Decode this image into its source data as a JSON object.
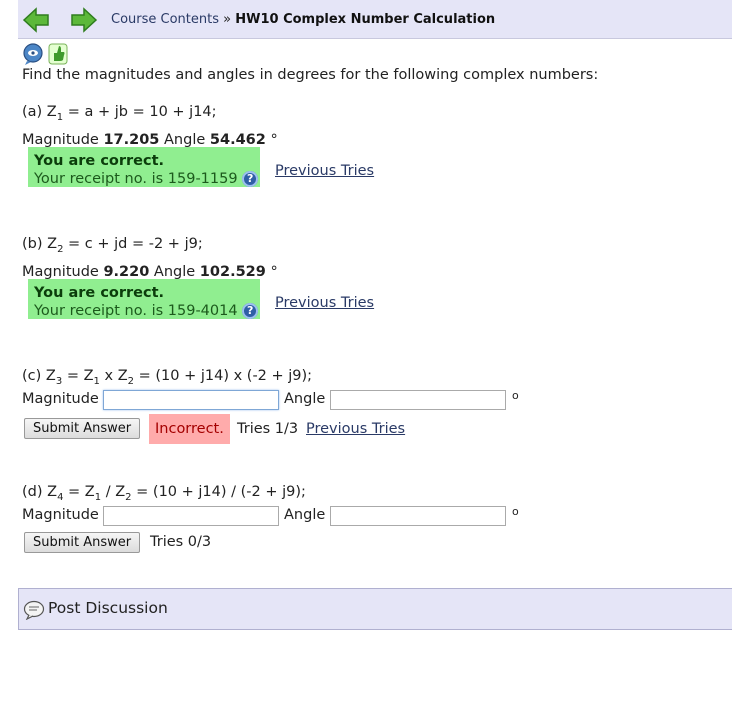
{
  "nav": {
    "back_icon": "back-arrow-icon",
    "forward_icon": "forward-arrow-icon",
    "breadcrumb_link": "Course Contents",
    "separator": "»",
    "current": "HW10 Complex Number Calculation"
  },
  "tools": {
    "icons": [
      "feedback-icon",
      "evaluate-icon"
    ]
  },
  "intro": "Find the magnitudes and angles in degrees for the following complex numbers:",
  "parts": {
    "a": {
      "label_pre": "(a) Z",
      "sub": "1",
      "label_post": " = a + jb = 10 + j14;",
      "mag_label": "Magnitude",
      "mag_value": "17.205",
      "angle_label": "Angle",
      "angle_value": "54.462",
      "deg": "°",
      "correct_title": "You are correct.",
      "receipt": "Your receipt no. is 159-1159",
      "previous": "Previous Tries"
    },
    "b": {
      "label_pre": "(b) Z",
      "sub": "2",
      "label_post": " = c + jd = -2 + j9;",
      "mag_label": "Magnitude",
      "mag_value": "9.220",
      "angle_label": "Angle",
      "angle_value": "102.529",
      "deg": "°",
      "correct_title": "You are correct.",
      "receipt": "Your receipt no. is 159-4014",
      "previous": "Previous Tries"
    },
    "c": {
      "label_pre": "(c) Z",
      "sub": "3",
      "mid1": " = Z",
      "sub1": "1",
      "mid2": " x Z",
      "sub2": "2",
      "label_post": " = (10 + j14) x (-2 + j9);",
      "mag_label": "Magnitude",
      "mag_value": "",
      "angle_label": "Angle",
      "angle_value": "",
      "deg": "o",
      "submit": "Submit Answer",
      "status": "Incorrect.",
      "tries": "Tries 1/3",
      "previous": "Previous Tries"
    },
    "d": {
      "label_pre": "(d) Z",
      "sub": "4",
      "mid1": " = Z",
      "sub1": "1",
      "mid2": " / Z",
      "sub2": "2",
      "label_post": " = (10 + j14) / (-2 + j9);",
      "mag_label": "Magnitude",
      "mag_value": "",
      "angle_label": "Angle",
      "angle_value": "",
      "deg": "o",
      "submit": "Submit Answer",
      "tries": "Tries 0/3"
    }
  },
  "help_glyph": "?",
  "discussion": {
    "icon": "discussion-icon",
    "label": "Post Discussion"
  },
  "colors": {
    "correct_bg": "#90ee90",
    "incorrect_bg": "#ffabab",
    "header_bg": "#e5e5f7"
  }
}
